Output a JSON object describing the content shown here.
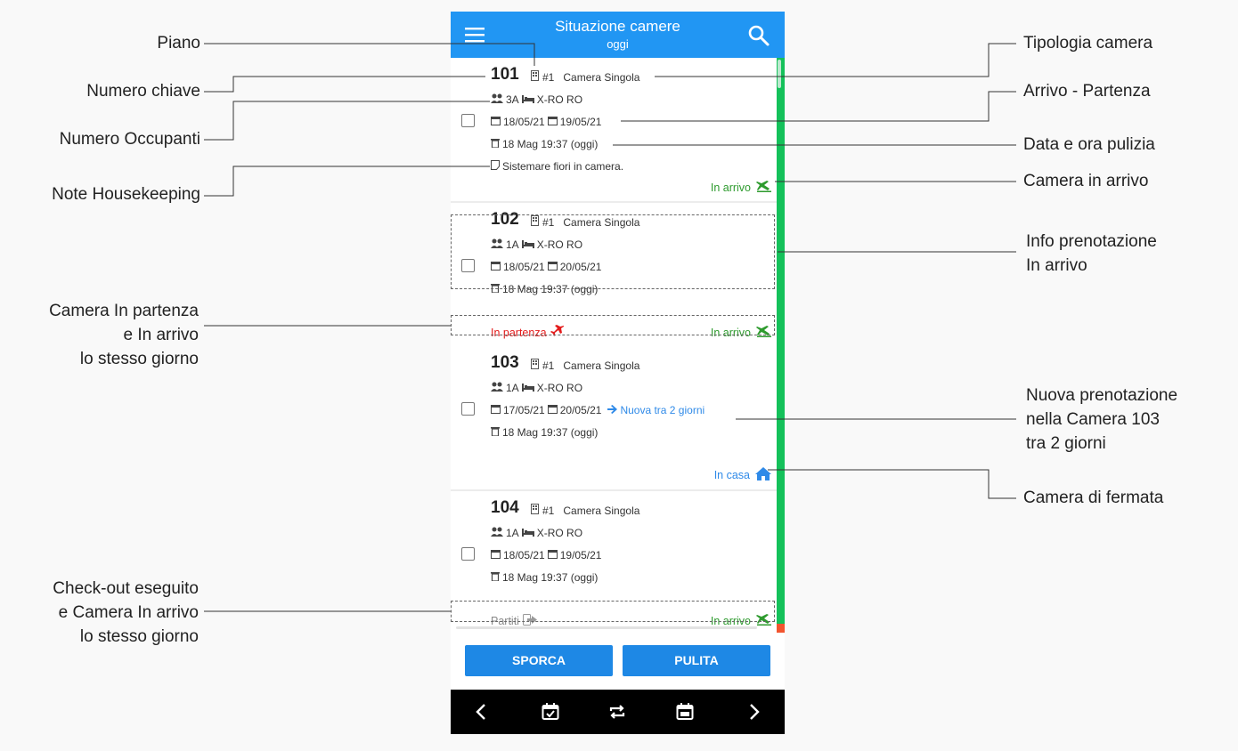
{
  "header": {
    "title": "Situazione camere",
    "subtitle": "oggi",
    "menu_icon": "menu-icon",
    "search_icon": "search-icon"
  },
  "rooms": [
    {
      "number": "101",
      "floor": "#1",
      "type": "Camera Singola",
      "occupants": "3A",
      "bed": "X-RO RO",
      "arrival": "18/05/21",
      "departure": "19/05/21",
      "cleaning": "18 Mag 19:37 (oggi)",
      "note": "Sistemare fiori in camera.",
      "status_right": "In arrivo"
    },
    {
      "number": "102",
      "floor": "#1",
      "type": "Camera Singola",
      "occupants": "1A",
      "bed": "X-RO RO",
      "arrival": "18/05/21",
      "departure": "20/05/21",
      "cleaning": "18 Mag 19:37 (oggi)",
      "status_left": "In partenza",
      "status_right": "In arrivo"
    },
    {
      "number": "103",
      "floor": "#1",
      "type": "Camera Singola",
      "occupants": "1A",
      "bed": "X-RO RO",
      "arrival": "17/05/21",
      "departure": "20/05/21",
      "next_booking": "Nuova tra 2 giorni",
      "cleaning": "18 Mag 19:37 (oggi)",
      "status_right": "In casa"
    },
    {
      "number": "104",
      "floor": "#1",
      "type": "Camera Singola",
      "occupants": "1A",
      "bed": "X-RO RO",
      "arrival": "18/05/21",
      "departure": "19/05/21",
      "cleaning": "18 Mag 19:37 (oggi)",
      "status_left": "Partiti",
      "status_right": "In arrivo"
    }
  ],
  "actions": {
    "dirty": "SPORCA",
    "clean": "PULITA"
  },
  "bottom_nav": [
    "chevron-left-icon",
    "calendar-check-icon",
    "repeat-icon",
    "calendar-icon",
    "chevron-right-icon"
  ],
  "colors": {
    "primary": "#2196f3",
    "button": "#1e88e5",
    "arrival": "#2e9b2e",
    "departure": "#e31b1b",
    "in_house": "#2f8ae8",
    "status_bar": "#14c15a",
    "status_bar_alert": "#f2552f"
  },
  "annotations": {
    "piano": "Piano",
    "numero_chiave": "Numero chiave",
    "numero_occupanti": "Numero Occupanti",
    "note_housekeeping": "Note Housekeeping",
    "camera_partenza_arrivo": [
      "Camera In partenza",
      "e In arrivo",
      "lo stesso giorno"
    ],
    "checkout_eseguito": [
      "Check-out eseguito",
      "e Camera In arrivo",
      "lo stesso giorno"
    ],
    "tipologia_camera": "Tipologia camera",
    "arrivo_partenza": "Arrivo - Partenza",
    "data_ora_pulizia": "Data e ora pulizia",
    "camera_in_arrivo": "Camera in arrivo",
    "info_prenotazione": [
      "Info prenotazione",
      "In arrivo"
    ],
    "nuova_prenotazione": [
      "Nuova prenotazione",
      "nella Camera 103",
      "tra 2 giorni"
    ],
    "camera_di_fermata": "Camera di fermata"
  }
}
